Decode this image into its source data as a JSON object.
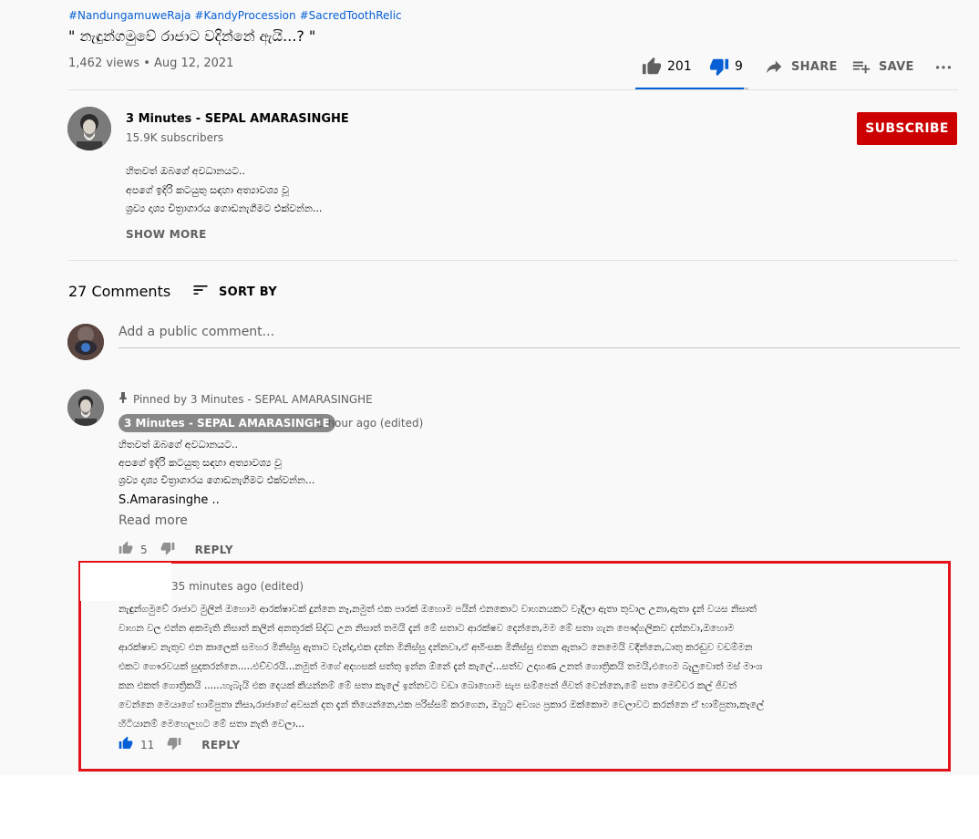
{
  "video": {
    "hashtags": [
      "#NandungamuweRaja",
      "#KandyProcession",
      "#SacredToothRelic"
    ],
    "title": "\" නැඳුන්ගමුවේ රාජාට වදින්නේ ඇයි...? \"",
    "views": "1,462 views",
    "separator": "•",
    "date": "Aug 12, 2021",
    "likes": "201",
    "dislikes": "9",
    "like_ratio": 0.957,
    "share_label": "SHARE",
    "save_label": "SAVE"
  },
  "channel": {
    "name": "3 Minutes - SEPAL AMARASINGHE",
    "subscribers": "15.9K subscribers",
    "subscribe_label": "SUBSCRIBE",
    "subscribe_color": "#cc0000"
  },
  "description": {
    "lines": [
      "හිතවත් ඔබගේ අවධානයට..",
      "අපගේ ඉදිරි කටයුතු සඳහා අත්‍යාවශ්‍ය වූ",
      "ශ්‍රව්‍ය දෘශ්‍ය චිත්‍රාගාරය ගොඩනැගීමට එක්වන්න..."
    ],
    "show_more_label": "SHOW MORE"
  },
  "comments": {
    "count_label": "27 Comments",
    "sort_label": "SORT BY",
    "add_placeholder": "Add a public comment...",
    "pinned": {
      "pinned_label": "Pinned by 3 Minutes - SEPAL AMARASINGHE",
      "author": "3 Minutes - SEPAL AMARASINGHE",
      "time": "1 hour ago (edited)",
      "lines": [
        "හිතවත් ඔබගේ අවධානයට..",
        "අපගේ ඉදිරි කටයුතු සඳහා අත්‍යාවශ්‍ය වූ",
        "ශ්‍රව්‍ය දෘශ්‍ය චිත්‍රාගාරය ගොඩනැගීමට එක්වන්න..."
      ],
      "signature": "S.Amarasinghe  ..",
      "read_more_label": "Read more",
      "likes": "5",
      "reply_label": "REPLY"
    },
    "second": {
      "time": "35 minutes ago (edited)",
      "lines": [
        "නැඳුන්ගමුවේ රාජාට මුලින් ඔහොම ආරක්ෂාවක් දුන්නෙ නෑ,නමුත් එක පාරක් ඔහොම පයින් එනකොට වාහනයකට වැදිලා ඇතා තුවාල උනා,ඇතා  දැන් වයස නිසාත්",
        "වාහන වල එන්න අකමැති නිසාත් කලින් අනතුරක් සිද්ධ උන නිසාත් තමයි දැන් මේ සතාට ආරක්ෂව දෙන්නෙ,මම මේ සතා ගැන පෞද්ගලිකව දන්නවා,ඔහොම",
        "ආරක්ෂාව නැතුව එන කාලෙක් සමහර මිනිස්සු ඇතාට වැන්දා,එක දන්න මිනිස්සු දන්නවා,ඒ අභිංසක මිනිස්සු එතන ඇතාට නෙමෙයි වදින්නෙ,ධාතු කරඬුව වඩම්මන",
        "එකට ගෞරවයක් සුදකරන්නෙ.....එච්චරයි...නමුත් මගේ අදහසක්  සත්තු ඉන්න ඕනේ දැන් කැලේ...සත්ව උදාහණ උනත් ගොත්‍රිකයි තමයි,එහෙම බැලුවොත් මස් මාංශ",
        "කන එකත් ගොත්‍රිකයි ......හැබැයි එක දෙයක් කියන්නම් මේ සතා කැලේ ඉන්නවට වඩා බොහොම සැප සම්පෙන් ජිවත් වෙන්නෙ,මේ සතා මෙච්චර කල් ජිවත්",
        "වෙන්නෙ මෙයාගේ භාම්පුතා නිසා,රාජාගේ අවසන් දත දැන් තියෙන්නෙ,එක පරිස්සම් කරගෙන, ඔහුට අවශ්‍ය ප්‍රකාර ඔක්කොම වෙලාවට කරන්නෙ ඒ භාම්පුතා,කැලේ",
        "හිටියානම් මෙහෙලහට මේ සතා නැති වෙලා..."
      ],
      "likes": "11",
      "reply_label": "REPLY"
    }
  },
  "colors": {
    "accent": "#065fd4",
    "highlight_border": "#e3131b",
    "secondary_text": "#606060"
  }
}
